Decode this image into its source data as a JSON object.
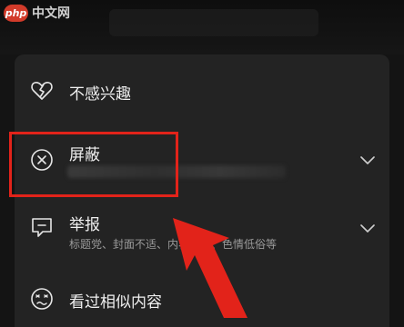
{
  "watermark": {
    "logo": "php",
    "site": "中文网"
  },
  "menu": {
    "items": [
      {
        "icon": "broken-heart-icon",
        "label": "不感兴趣"
      },
      {
        "icon": "circle-x-icon",
        "label": "屏蔽"
      },
      {
        "icon": "report-message-icon",
        "label": "举报",
        "subtitle": "标题党、封面不适、内容过时、色情低俗等"
      },
      {
        "icon": "dizzy-face-icon",
        "label": "看过相似内容"
      }
    ]
  },
  "annotations": {
    "highlight_color": "#e2231a",
    "arrow_color": "#e2231a"
  }
}
